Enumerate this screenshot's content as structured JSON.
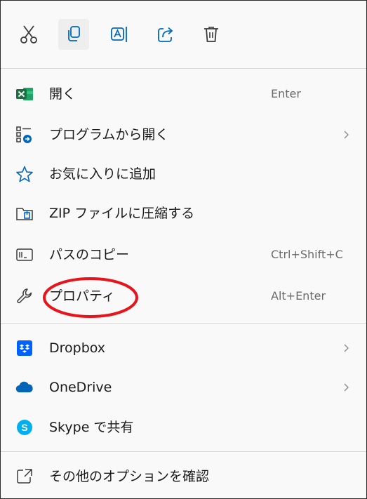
{
  "toolbar": {
    "buttons": [
      {
        "name": "cut",
        "icon": "scissors-icon"
      },
      {
        "name": "copy",
        "icon": "copy-icon"
      },
      {
        "name": "rename",
        "icon": "rename-icon"
      },
      {
        "name": "share",
        "icon": "share-icon"
      },
      {
        "name": "delete",
        "icon": "trash-icon"
      }
    ]
  },
  "items": [
    {
      "label": "開く",
      "shortcut": "Enter",
      "icon": "excel-icon"
    },
    {
      "label": "プログラムから開く",
      "icon": "open-with-icon",
      "submenu": true
    },
    {
      "label": "お気に入りに追加",
      "icon": "star-icon"
    },
    {
      "label": "ZIP ファイルに圧縮する",
      "icon": "zip-folder-icon"
    },
    {
      "label": "パスのコピー",
      "shortcut": "Ctrl+Shift+C",
      "icon": "copy-path-icon"
    },
    {
      "label": "プロパティ",
      "shortcut": "Alt+Enter",
      "icon": "wrench-icon",
      "highlighted": true
    },
    {
      "label": "Dropbox",
      "icon": "dropbox-icon",
      "submenu": true
    },
    {
      "label": "OneDrive",
      "icon": "onedrive-icon",
      "submenu": true
    },
    {
      "label": "Skype で共有",
      "icon": "skype-icon"
    },
    {
      "label": "その他のオプションを確認",
      "icon": "more-options-icon"
    }
  ],
  "colors": {
    "accent": "#0067c0",
    "excel": "#1d6f42",
    "dropbox": "#0061fe",
    "onedrive": "#0364b8",
    "skype": "#00aff0",
    "annotation": "#e8141c"
  }
}
